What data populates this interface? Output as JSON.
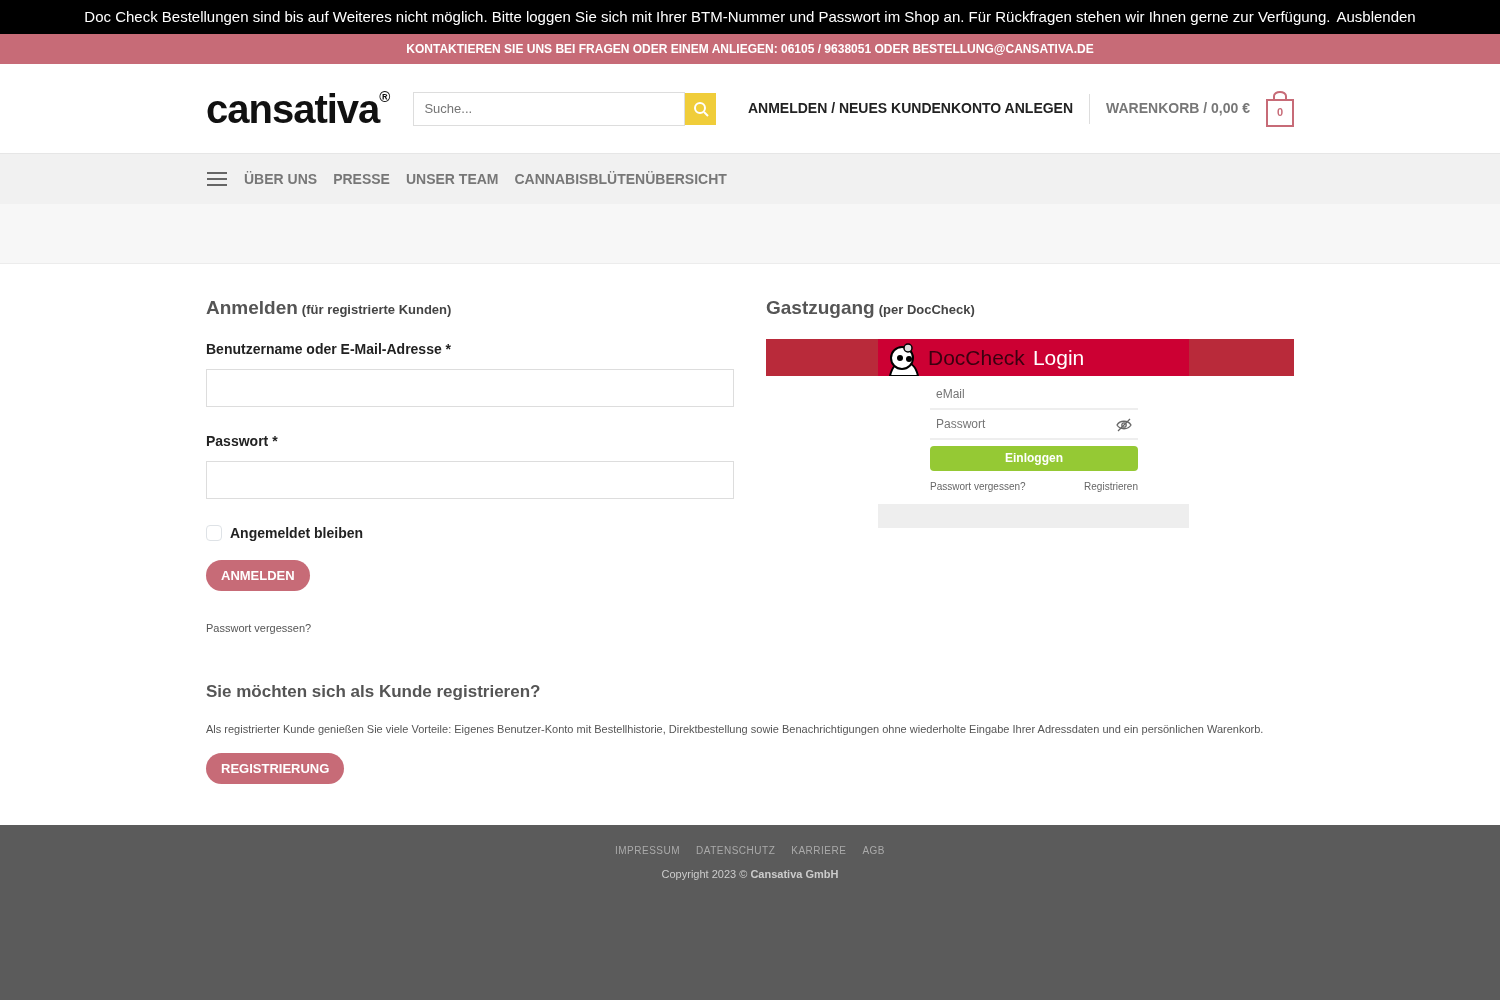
{
  "notice_bar": {
    "text": "Doc Check Bestellungen sind bis auf Weiteres nicht möglich. Bitte loggen Sie sich mit Ihrer BTM-Nummer und Passwort im Shop an. Für Rückfragen stehen wir Ihnen gerne zur Verfügung.",
    "dismiss": "Ausblenden"
  },
  "contact_bar": {
    "text": "KONTAKTIEREN SIE UNS BEI FRAGEN ODER EINEM ANLIEGEN: 06105 / 9638051 ODER BESTELLUNG@CANSATIVA.DE"
  },
  "header": {
    "logo": "cansativa",
    "logo_mark": "®",
    "search": {
      "placeholder": "Suche..."
    },
    "account_link": "ANMELDEN / NEUES KUNDENKONTO ANLEGEN",
    "cart_link": "WARENKORB / 0,00 €",
    "cart_count": "0"
  },
  "nav": {
    "items": [
      "ÜBER UNS",
      "PRESSE",
      "UNSER TEAM",
      "CANNABISBLÜTENÜBERSICHT"
    ]
  },
  "login": {
    "title": "Anmelden",
    "subtitle": "(für registrierte Kunden)",
    "fields": [
      {
        "label": "Benutzername oder E-Mail-Adresse *"
      },
      {
        "label": "Passwort *"
      }
    ],
    "remember": {
      "label": "Angemeldet bleiben",
      "checked": false
    },
    "button": "ANMELDEN",
    "forgot": "Passwort vergessen?"
  },
  "guest": {
    "title": "Gastzugang",
    "subtitle": "(per DocCheck)",
    "doccheck": {
      "brand": "DocCheck",
      "brand_suffix": "Login",
      "email_placeholder": "eMail",
      "password_placeholder": "Passwort",
      "button": "Einloggen",
      "forgot": "Passwort vergessen?",
      "register": "Registrieren"
    }
  },
  "register": {
    "title": "Sie möchten sich als Kunde registrieren?",
    "text": "Als registrierter Kunde genießen Sie viele Vorteile: Eigenes Benutzer-Konto mit Bestellhistorie, Direktbestellung sowie Benachrichtigungen ohne wiederholte Eingabe Ihrer Adressdaten und ein persönlichen Warenkorb.",
    "button": "REGISTRIERUNG"
  },
  "footer": {
    "links": [
      "IMPRESSUM",
      "DATENSCHUTZ",
      "KARRIERE",
      "AGB"
    ],
    "copyright": "Copyright 2023 © **Cansativa GmbH**"
  }
}
